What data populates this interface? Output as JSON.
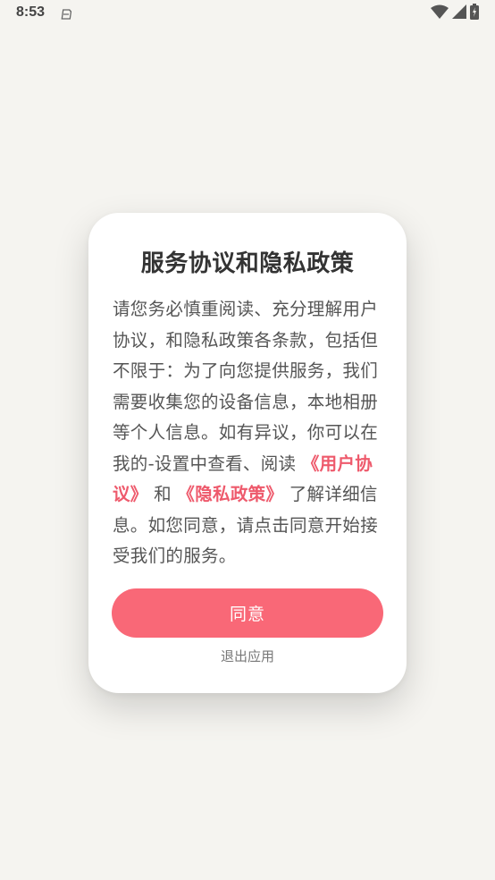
{
  "status_bar": {
    "time": "8:53",
    "icons": [
      "notification-icon",
      "wifi-icon",
      "signal-icon",
      "battery-icon"
    ]
  },
  "dialog": {
    "title": "服务协议和隐私政策",
    "body_part1": "请您务必慎重阅读、充分理解用户协议，和隐私政策各条款，包括但不限于：为了向您提供服务，我们需要收集您的设备信息，本地相册等个人信息。如有异议，你可以在我的-设置中查看、阅读 ",
    "user_agreement_link": "《用户协议》",
    "conjunction": "和",
    "privacy_policy_link": "《隐私政策》",
    "body_part2": "了解详细信息。如您同意，请点击同意开始接受我们的服务。",
    "agree_label": "同意",
    "exit_label": "退出应用"
  },
  "colors": {
    "background": "#f5f4f0",
    "accent": "#f96877",
    "link": "#ee5a6c",
    "dialog_bg": "#ffffff"
  }
}
